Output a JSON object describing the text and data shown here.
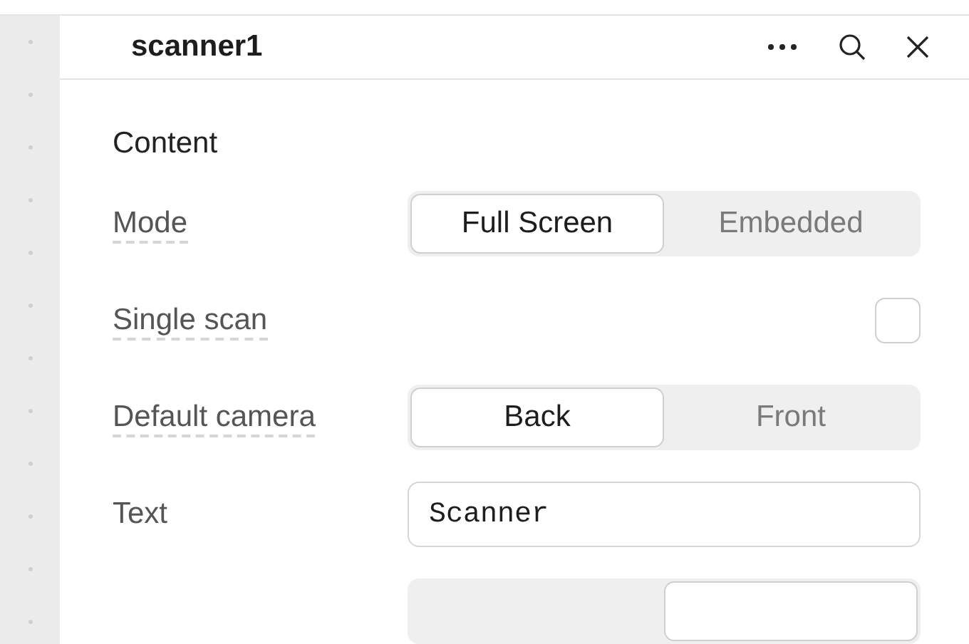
{
  "panel": {
    "title": "scanner1"
  },
  "section": {
    "title": "Content"
  },
  "rows": [
    {
      "kind": "segmented",
      "label": "Mode",
      "has_tooltip": true,
      "options": [
        {
          "label": "Full Screen",
          "selected": true
        },
        {
          "label": "Embedded",
          "selected": false
        }
      ]
    },
    {
      "kind": "checkbox",
      "label": "Single scan",
      "has_tooltip": true,
      "checked": false
    },
    {
      "kind": "segmented",
      "label": "Default camera",
      "has_tooltip": true,
      "options": [
        {
          "label": "Back",
          "selected": true
        },
        {
          "label": "Front",
          "selected": false
        }
      ]
    },
    {
      "kind": "text",
      "label": "Text",
      "has_tooltip": false,
      "value": "Scanner"
    },
    {
      "kind": "cut_segmented",
      "options": [
        {
          "selected": false
        },
        {
          "selected": true
        }
      ]
    }
  ]
}
